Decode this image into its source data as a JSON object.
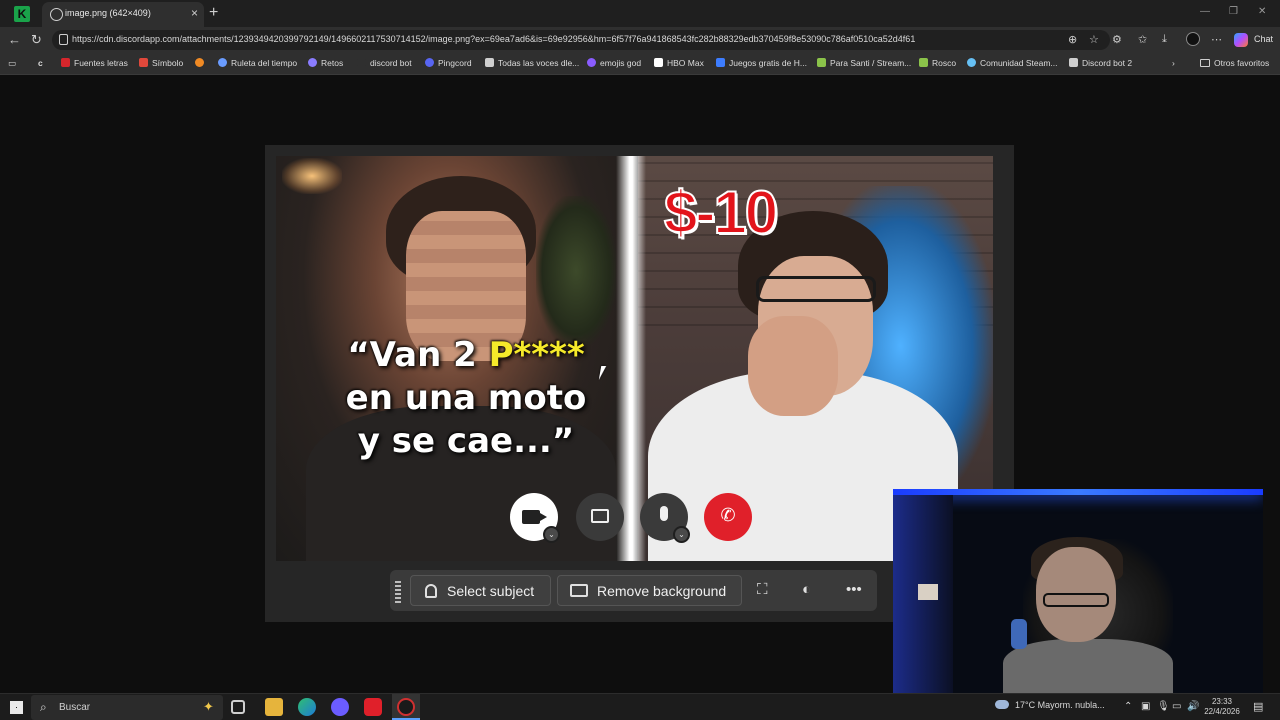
{
  "browser": {
    "tab_title": "image.png (642×409)",
    "url": "https://cdn.discordapp.com/attachments/1239349420399792149/1496602117530714152/image.png?ex=69ea7ad6&is=69e92956&hm=6f57f76a941868543fc282b88329edb370459f8e53090c786af0510ca52d4f61",
    "chat_label": "Chat",
    "new_tab_symbol": "+",
    "close_tab_symbol": "×"
  },
  "bookmarks": {
    "items": [
      {
        "label": "Fuentes letras",
        "color": "#d6262c"
      },
      {
        "label": "Símbolo",
        "color": "#e0483b"
      },
      {
        "label": "",
        "color": "#f08a24"
      },
      {
        "label": "Ruleta del tiempo",
        "color": "#6a9cff"
      },
      {
        "label": "Retos",
        "color": "#8a7cff"
      },
      {
        "label": "discord bot",
        "color": "#2f2f2f"
      },
      {
        "label": "Pingcord",
        "color": "#5865f2"
      },
      {
        "label": "Todas las voces dle...",
        "color": "#cfcfcf"
      },
      {
        "label": "emojis god",
        "color": "#8a5cff"
      },
      {
        "label": "HBO Max",
        "color": "#ffffff"
      },
      {
        "label": "Juegos gratis de H...",
        "color": "#3d7dff"
      },
      {
        "label": "Para Santi / Stream...",
        "color": "#8bc34a"
      },
      {
        "label": "Rosco",
        "color": "#8bc34a"
      },
      {
        "label": "Comunidad Steam...",
        "color": "#66c0f4"
      },
      {
        "label": "Discord bot 2",
        "color": "#cfcfcf"
      }
    ],
    "other_label": "Otros favoritos"
  },
  "thumbnail": {
    "price_text": "$-10",
    "quote_line1_prefix": "“Van 2 ",
    "quote_line1_highlight": "P****",
    "quote_line2": "en una moto",
    "quote_line3": "y se cae...”"
  },
  "call_controls": {
    "camera_icon": "video-camera-icon",
    "screen_share_icon": "screen-share-icon",
    "mic_icon": "microphone-icon",
    "hangup_icon": "hang-up-icon",
    "chevron": "⌄",
    "hangup_color": "#e0202a"
  },
  "edit_toolbar": {
    "select_subject_label": "Select subject",
    "remove_background_label": "Remove background",
    "more_label": "•••"
  },
  "taskbar": {
    "search_placeholder": "Buscar",
    "weather_text": "17°C  Mayorm. nubla...",
    "time": "23:33",
    "date": "22/4/2026"
  }
}
